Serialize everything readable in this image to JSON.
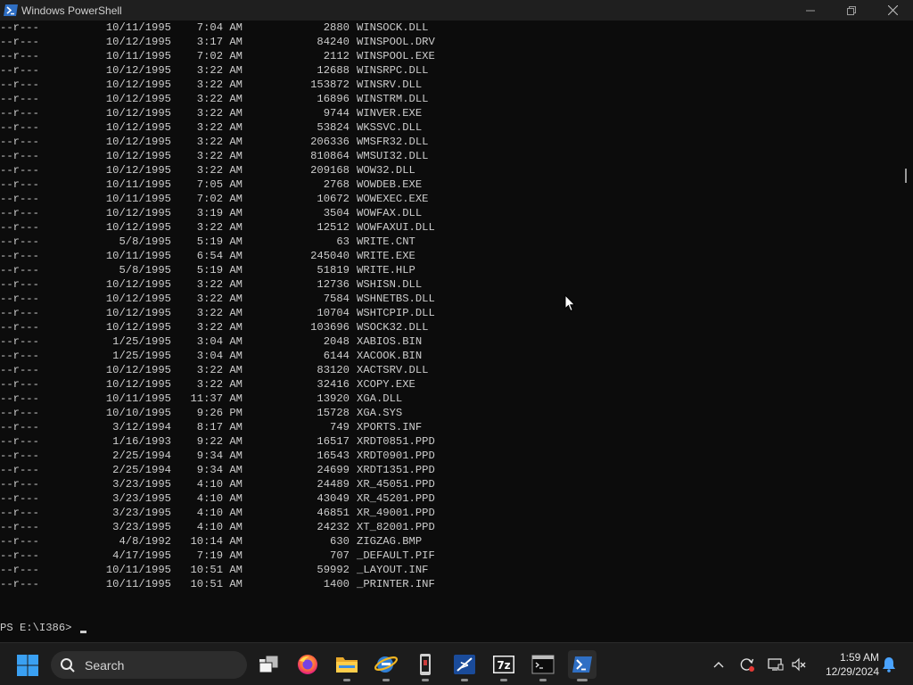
{
  "window": {
    "title": "Windows PowerShell"
  },
  "console": {
    "entries": [
      {
        "mode": "--r---",
        "date": "10/11/1995",
        "time": "7:04 AM",
        "length": "2880",
        "name": "WINSOCK.DLL"
      },
      {
        "mode": "--r---",
        "date": "10/12/1995",
        "time": "3:17 AM",
        "length": "84240",
        "name": "WINSPOOL.DRV"
      },
      {
        "mode": "--r---",
        "date": "10/11/1995",
        "time": "7:02 AM",
        "length": "2112",
        "name": "WINSPOOL.EXE"
      },
      {
        "mode": "--r---",
        "date": "10/12/1995",
        "time": "3:22 AM",
        "length": "12688",
        "name": "WINSRPC.DLL"
      },
      {
        "mode": "--r---",
        "date": "10/12/1995",
        "time": "3:22 AM",
        "length": "153872",
        "name": "WINSRV.DLL"
      },
      {
        "mode": "--r---",
        "date": "10/12/1995",
        "time": "3:22 AM",
        "length": "16896",
        "name": "WINSTRM.DLL"
      },
      {
        "mode": "--r---",
        "date": "10/12/1995",
        "time": "3:22 AM",
        "length": "9744",
        "name": "WINVER.EXE"
      },
      {
        "mode": "--r---",
        "date": "10/12/1995",
        "time": "3:22 AM",
        "length": "53824",
        "name": "WKSSVC.DLL"
      },
      {
        "mode": "--r---",
        "date": "10/12/1995",
        "time": "3:22 AM",
        "length": "206336",
        "name": "WMSFR32.DLL"
      },
      {
        "mode": "--r---",
        "date": "10/12/1995",
        "time": "3:22 AM",
        "length": "810864",
        "name": "WMSUI32.DLL"
      },
      {
        "mode": "--r---",
        "date": "10/12/1995",
        "time": "3:22 AM",
        "length": "209168",
        "name": "WOW32.DLL"
      },
      {
        "mode": "--r---",
        "date": "10/11/1995",
        "time": "7:05 AM",
        "length": "2768",
        "name": "WOWDEB.EXE"
      },
      {
        "mode": "--r---",
        "date": "10/11/1995",
        "time": "7:02 AM",
        "length": "10672",
        "name": "WOWEXEC.EXE"
      },
      {
        "mode": "--r---",
        "date": "10/12/1995",
        "time": "3:19 AM",
        "length": "3504",
        "name": "WOWFAX.DLL"
      },
      {
        "mode": "--r---",
        "date": "10/12/1995",
        "time": "3:22 AM",
        "length": "12512",
        "name": "WOWFAXUI.DLL"
      },
      {
        "mode": "--r---",
        "date": "5/8/1995",
        "time": "5:19 AM",
        "length": "63",
        "name": "WRITE.CNT"
      },
      {
        "mode": "--r---",
        "date": "10/11/1995",
        "time": "6:54 AM",
        "length": "245040",
        "name": "WRITE.EXE"
      },
      {
        "mode": "--r---",
        "date": "5/8/1995",
        "time": "5:19 AM",
        "length": "51819",
        "name": "WRITE.HLP"
      },
      {
        "mode": "--r---",
        "date": "10/12/1995",
        "time": "3:22 AM",
        "length": "12736",
        "name": "WSHISN.DLL"
      },
      {
        "mode": "--r---",
        "date": "10/12/1995",
        "time": "3:22 AM",
        "length": "7584",
        "name": "WSHNETBS.DLL"
      },
      {
        "mode": "--r---",
        "date": "10/12/1995",
        "time": "3:22 AM",
        "length": "10704",
        "name": "WSHTCPIP.DLL"
      },
      {
        "mode": "--r---",
        "date": "10/12/1995",
        "time": "3:22 AM",
        "length": "103696",
        "name": "WSOCK32.DLL"
      },
      {
        "mode": "--r---",
        "date": "1/25/1995",
        "time": "3:04 AM",
        "length": "2048",
        "name": "XABIOS.BIN"
      },
      {
        "mode": "--r---",
        "date": "1/25/1995",
        "time": "3:04 AM",
        "length": "6144",
        "name": "XACOOK.BIN"
      },
      {
        "mode": "--r---",
        "date": "10/12/1995",
        "time": "3:22 AM",
        "length": "83120",
        "name": "XACTSRV.DLL"
      },
      {
        "mode": "--r---",
        "date": "10/12/1995",
        "time": "3:22 AM",
        "length": "32416",
        "name": "XCOPY.EXE"
      },
      {
        "mode": "--r---",
        "date": "10/11/1995",
        "time": "11:37 AM",
        "length": "13920",
        "name": "XGA.DLL"
      },
      {
        "mode": "--r---",
        "date": "10/10/1995",
        "time": "9:26 PM",
        "length": "15728",
        "name": "XGA.SYS"
      },
      {
        "mode": "--r---",
        "date": "3/12/1994",
        "time": "8:17 AM",
        "length": "749",
        "name": "XPORTS.INF"
      },
      {
        "mode": "--r---",
        "date": "1/16/1993",
        "time": "9:22 AM",
        "length": "16517",
        "name": "XRDT0851.PPD"
      },
      {
        "mode": "--r---",
        "date": "2/25/1994",
        "time": "9:34 AM",
        "length": "16543",
        "name": "XRDT0901.PPD"
      },
      {
        "mode": "--r---",
        "date": "2/25/1994",
        "time": "9:34 AM",
        "length": "24699",
        "name": "XRDT1351.PPD"
      },
      {
        "mode": "--r---",
        "date": "3/23/1995",
        "time": "4:10 AM",
        "length": "24489",
        "name": "XR_45051.PPD"
      },
      {
        "mode": "--r---",
        "date": "3/23/1995",
        "time": "4:10 AM",
        "length": "43049",
        "name": "XR_45201.PPD"
      },
      {
        "mode": "--r---",
        "date": "3/23/1995",
        "time": "4:10 AM",
        "length": "46851",
        "name": "XR_49001.PPD"
      },
      {
        "mode": "--r---",
        "date": "3/23/1995",
        "time": "4:10 AM",
        "length": "24232",
        "name": "XT_82001.PPD"
      },
      {
        "mode": "--r---",
        "date": "4/8/1992",
        "time": "10:14 AM",
        "length": "630",
        "name": "ZIGZAG.BMP"
      },
      {
        "mode": "--r---",
        "date": "4/17/1995",
        "time": "7:19 AM",
        "length": "707",
        "name": "_DEFAULT.PIF"
      },
      {
        "mode": "--r---",
        "date": "10/11/1995",
        "time": "10:51 AM",
        "length": "59992",
        "name": "_LAYOUT.INF"
      },
      {
        "mode": "--r---",
        "date": "10/11/1995",
        "time": "10:51 AM",
        "length": "1400",
        "name": "_PRINTER.INF"
      }
    ],
    "prompt": "PS E:\\I386> "
  },
  "taskbar": {
    "search_label": "Search",
    "apps": [
      {
        "icon": "task-view-icon"
      },
      {
        "icon": "firefox-icon"
      },
      {
        "icon": "file-explorer-icon"
      },
      {
        "icon": "internet-explorer-icon"
      },
      {
        "icon": "device-app-icon"
      },
      {
        "icon": "virtualbox-icon"
      },
      {
        "icon": "7zip-icon"
      },
      {
        "icon": "command-prompt-icon"
      },
      {
        "icon": "powershell-icon"
      }
    ],
    "time": "1:59 AM",
    "date": "12/29/2024"
  },
  "colors": {
    "console_bg": "#0c0c0c",
    "console_fg": "#cccccc",
    "powershell_blue": "#1f5fa8",
    "notification_blue": "#4aa3ff"
  }
}
